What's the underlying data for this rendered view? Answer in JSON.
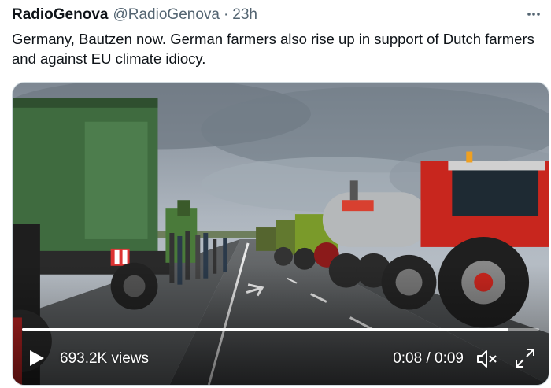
{
  "tweet": {
    "display_name": "RadioGenova",
    "handle": "@RadioGenova",
    "separator": "·",
    "time_ago": "23h",
    "text": "Germany, Bautzen now. German farmers also rise up in support of Dutch farmers and against EU climate idiocy."
  },
  "video": {
    "views": "693.2K views",
    "time": "0:08 / 0:09",
    "progress": 0.94
  },
  "icons": {
    "more": "more-horizontal-icon",
    "play": "play-icon",
    "mute": "muted-speaker-icon",
    "fullscreen": "fullscreen-expand-icon"
  },
  "colors": {
    "text": "#0f1419",
    "secondary_text": "#536471",
    "border": "#cfd9de"
  }
}
